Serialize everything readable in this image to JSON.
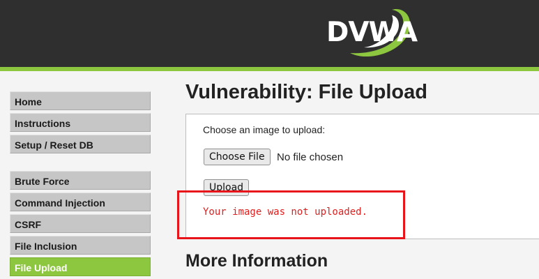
{
  "header": {
    "logo_text": "DVWA",
    "colors": {
      "background": "#2f2f2f",
      "accent": "#8dc63f"
    }
  },
  "sidebar": {
    "items": [
      {
        "label": "Home"
      },
      {
        "label": "Instructions"
      },
      {
        "label": "Setup / Reset DB"
      },
      {
        "label": "Brute Force"
      },
      {
        "label": "Command Injection"
      },
      {
        "label": "CSRF"
      },
      {
        "label": "File Inclusion"
      },
      {
        "label": "File Upload",
        "selected": true
      }
    ]
  },
  "main": {
    "title": "Vulnerability: File Upload",
    "form": {
      "prompt": "Choose an image to upload:",
      "choose_file_label": "Choose File",
      "file_status": "No file chosen",
      "upload_label": "Upload",
      "result_message": "Your image was not uploaded."
    },
    "more_info_heading": "More Information"
  },
  "annotation": {
    "highlight_color": "#e8141a"
  }
}
